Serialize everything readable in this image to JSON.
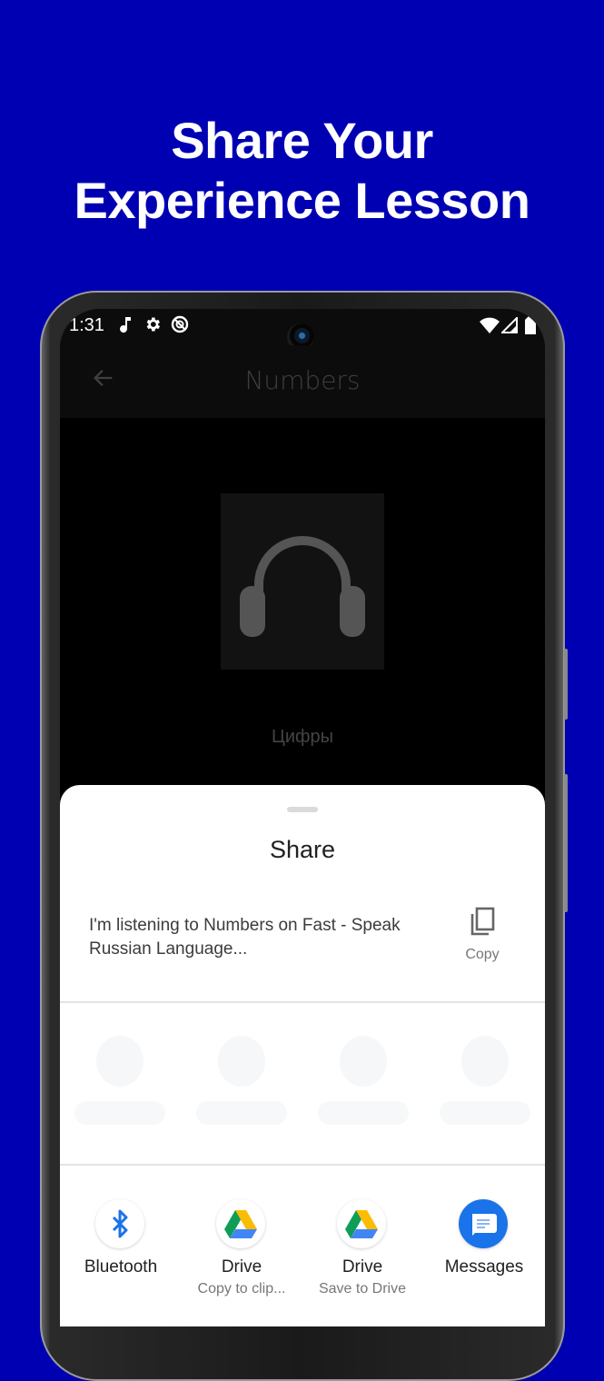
{
  "promo": {
    "headline_line1": "Share Your",
    "headline_line2": "Experience Lesson",
    "background_color": "#0000b3"
  },
  "statusbar": {
    "time": "1:31",
    "left_icons": [
      "music-note-icon",
      "gear-icon",
      "do-not-disturb-icon"
    ],
    "right_icons": [
      "wifi-icon",
      "cellular-signal-icon",
      "battery-icon"
    ]
  },
  "appbar": {
    "back_icon": "arrow-left-icon",
    "title": "Numbers"
  },
  "lesson": {
    "cover_icon": "headphones-icon",
    "subtitle": "Цифры"
  },
  "share_sheet": {
    "title": "Share",
    "share_text": "I'm listening to Numbers on Fast - Speak Russian Language...",
    "copy_label": "Copy",
    "loading_placeholders": 4,
    "targets": [
      {
        "label": "Bluetooth",
        "sublabel": "",
        "icon": "bluetooth-icon"
      },
      {
        "label": "Drive",
        "sublabel": "Copy to clip...",
        "icon": "google-drive-icon"
      },
      {
        "label": "Drive",
        "sublabel": "Save to Drive",
        "icon": "google-drive-icon"
      },
      {
        "label": "Messages",
        "sublabel": "",
        "icon": "messages-icon"
      }
    ]
  }
}
